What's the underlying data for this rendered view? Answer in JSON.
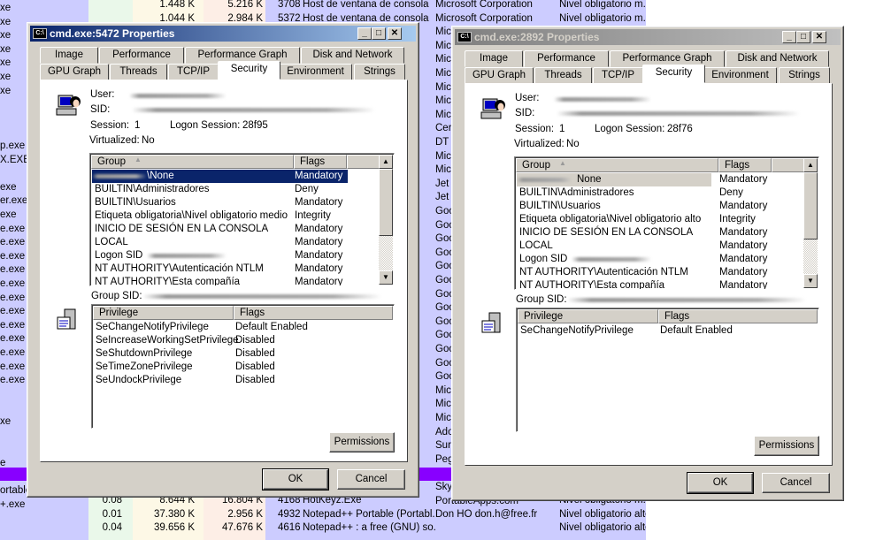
{
  "background": {
    "colors": {
      "name_col": "#ccccff",
      "cpu_col": "#eaf8ea",
      "mem_col": "#fdf8e6",
      "ws_col": "#fdeee6",
      "desc_col": "#ccccff",
      "highlight": "#8800ff"
    },
    "name_fragments": [
      "xe",
      "xe",
      "xe",
      "xe",
      "xe",
      "xe",
      "xe",
      "",
      "",
      "",
      "p.exe",
      "X.EXE",
      "",
      "exe",
      "er.exe",
      "exe",
      "e.exe",
      "e.exe",
      "e.exe",
      "e.exe",
      "e.exe",
      "e.exe",
      "e.exe",
      "e.exe",
      "e.exe",
      "e.exe",
      "e.exe",
      "e.exe",
      "",
      "",
      "xe",
      "",
      "",
      "e",
      "exe",
      "ortable.exe",
      "+.exe"
    ],
    "company_fragments": [
      "Microsoft Corporation",
      "Microsoft Corporation",
      "Mic",
      "Mic",
      "Mic",
      "Mic",
      "Mic",
      "Mic",
      "Mic",
      "Cer",
      "DT",
      "Mic",
      "Mic",
      "Jet",
      "Jet",
      "Goo",
      "Goo",
      "Goo",
      "Goo",
      "Goo",
      "Goo",
      "Goo",
      "Goo",
      "Goo",
      "Goo",
      "Goo",
      "Goo",
      "Goo",
      "Mic",
      "Mic",
      "Mic",
      "Ado",
      "Sur",
      "Peg",
      "AIM",
      "SkyNergy",
      "PortableApps.com",
      "Don HO don.h@free.fr"
    ],
    "top_rows": [
      {
        "cpu": "",
        "private": "1.448 K",
        "ws": "5.216 K",
        "pid": "3708",
        "desc": "Host de ventana de consola",
        "integrity": "Nivel obligatorio m..."
      },
      {
        "cpu": "",
        "private": "1.044 K",
        "ws": "2.984 K",
        "pid": "5372",
        "desc": "Host de ventana de consola",
        "integrity": "Nivel obligatorio m..."
      }
    ],
    "bottom_rows": [
      {
        "cpu": "0.08",
        "private": "8.644 K",
        "ws": "16.804 K",
        "pid": "4168",
        "desc": "HotKeyz.Exe",
        "integrity": "Nivel obligatorio m..."
      },
      {
        "cpu": "0.01",
        "private": "37.380 K",
        "ws": "2.956 K",
        "pid": "4932",
        "desc": "Notepad++ Portable (Portabl...",
        "integrity": "Nivel obligatorio alto"
      },
      {
        "cpu": "0.04",
        "private": "39.656 K",
        "ws": "47.676 K",
        "pid": "4616",
        "desc": "Notepad++ : a free (GNU) so...",
        "integrity": "Nivel obligatorio alto"
      }
    ]
  },
  "tabs_row1": [
    "Image",
    "Performance",
    "Performance Graph",
    "Disk and Network"
  ],
  "tabs_row2": [
    "GPU Graph",
    "Threads",
    "TCP/IP",
    "Security",
    "Environment",
    "Strings"
  ],
  "selected_tab": "Security",
  "labels": {
    "user": "User:",
    "sid": "SID:",
    "session": "Session:",
    "logon_session": "Logon Session:",
    "virtualized": "Virtualized:",
    "group_sid": "Group SID:",
    "group_col": "Group",
    "flags_col": "Flags",
    "privilege_col": "Privilege",
    "permissions": "Permissions",
    "ok": "OK",
    "cancel": "Cancel"
  },
  "dialogs": [
    {
      "title": "cmd.exe:5472 Properties",
      "active": true,
      "session": "1",
      "logon_session": "28f95",
      "virtualized": "No",
      "groups": [
        [
          "\\None",
          "Mandatory"
        ],
        [
          "BUILTIN\\Administradores",
          "Deny"
        ],
        [
          "BUILTIN\\Usuarios",
          "Mandatory"
        ],
        [
          "Etiqueta obligatoria\\Nivel obligatorio medio",
          "Integrity"
        ],
        [
          "INICIO DE SESIÓN EN LA CONSOLA",
          "Mandatory"
        ],
        [
          "LOCAL",
          "Mandatory"
        ],
        [
          "Logon SID",
          "Mandatory"
        ],
        [
          "NT AUTHORITY\\Autenticación NTLM",
          "Mandatory"
        ],
        [
          "NT AUTHORITY\\Esta compañía",
          "Mandatory"
        ]
      ],
      "privileges": [
        [
          "SeChangeNotifyPrivilege",
          "Default Enabled"
        ],
        [
          "SeIncreaseWorkingSetPrivilege",
          "Disabled"
        ],
        [
          "SeShutdownPrivilege",
          "Disabled"
        ],
        [
          "SeTimeZonePrivilege",
          "Disabled"
        ],
        [
          "SeUndockPrivilege",
          "Disabled"
        ]
      ]
    },
    {
      "title": "cmd.exe:2892 Properties",
      "active": false,
      "session": "1",
      "logon_session": "28f76",
      "virtualized": "No",
      "groups": [
        [
          "None",
          "Mandatory"
        ],
        [
          "BUILTIN\\Administradores",
          "Deny"
        ],
        [
          "BUILTIN\\Usuarios",
          "Mandatory"
        ],
        [
          "Etiqueta obligatoria\\Nivel obligatorio alto",
          "Integrity"
        ],
        [
          "INICIO DE SESIÓN EN LA CONSOLA",
          "Mandatory"
        ],
        [
          "LOCAL",
          "Mandatory"
        ],
        [
          "Logon SID",
          "Mandatory"
        ],
        [
          "NT AUTHORITY\\Autenticación NTLM",
          "Mandatory"
        ],
        [
          "NT AUTHORITY\\Esta compañía",
          "Mandatory"
        ]
      ],
      "privileges": [
        [
          "SeChangeNotifyPrivilege",
          "Default Enabled"
        ]
      ]
    }
  ]
}
